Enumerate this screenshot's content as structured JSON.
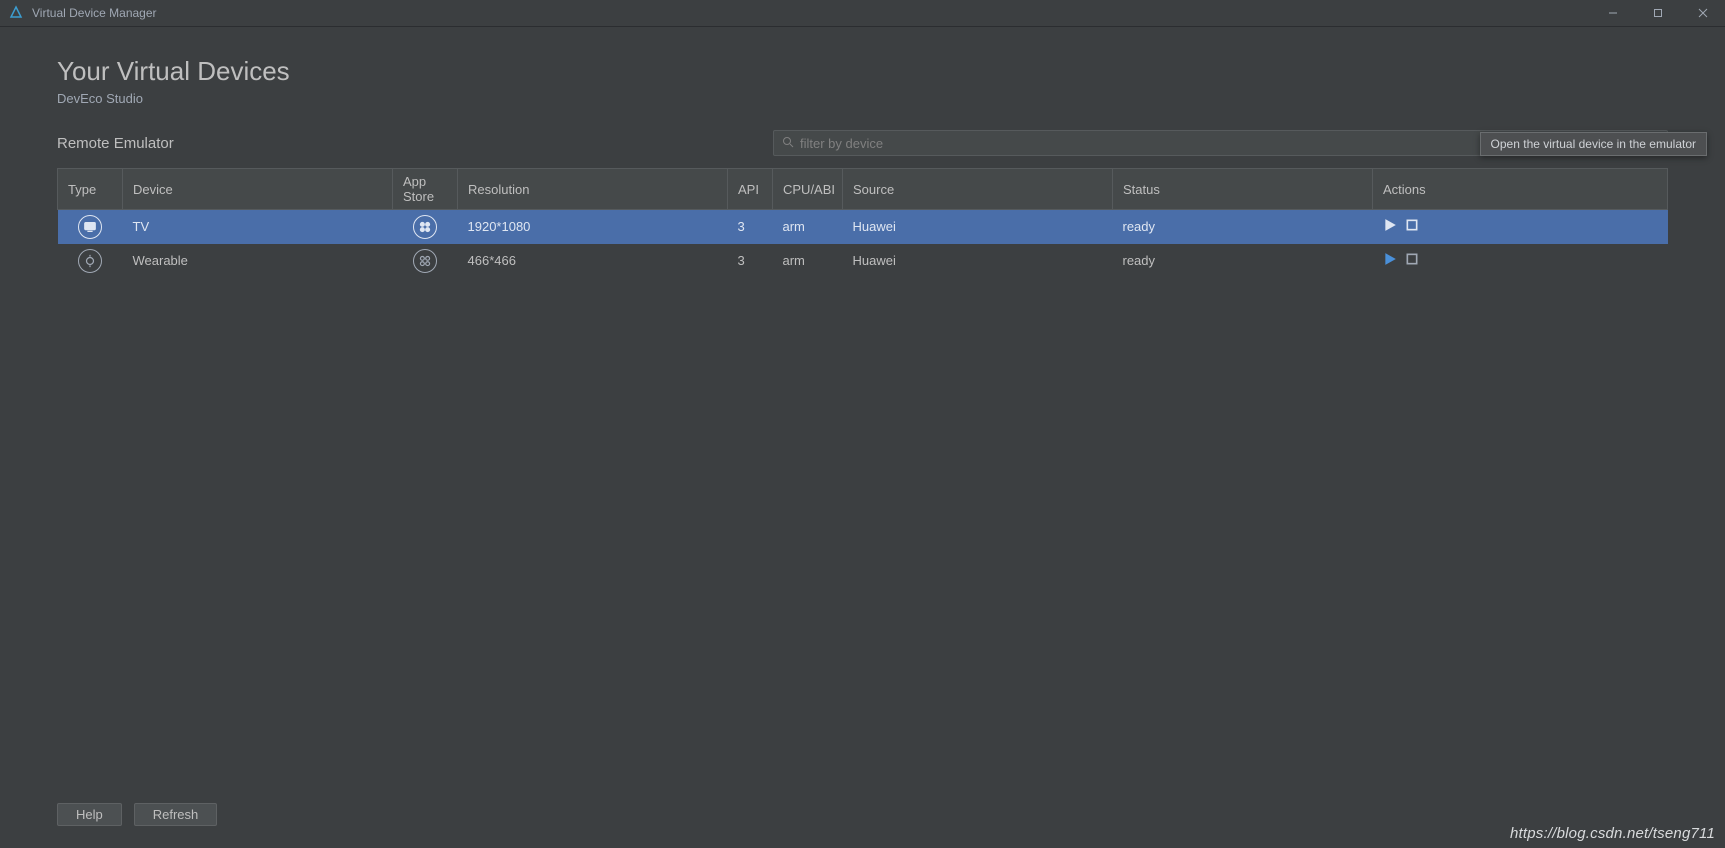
{
  "window": {
    "title": "Virtual Device Manager"
  },
  "header": {
    "title": "Your Virtual Devices",
    "subtitle": "DevEco Studio"
  },
  "section": {
    "label": "Remote Emulator"
  },
  "search": {
    "placeholder": "filter by device",
    "value": ""
  },
  "table": {
    "columns": {
      "type": "Type",
      "device": "Device",
      "appstore": "App Store",
      "resolution": "Resolution",
      "api": "API",
      "cpu": "CPU/ABI",
      "source": "Source",
      "status": "Status",
      "actions": "Actions"
    },
    "rows": [
      {
        "type_icon": "tv",
        "device": "TV",
        "appstore_icon": "appstore",
        "resolution": "1920*1080",
        "api": "3",
        "cpu": "arm",
        "source": "Huawei",
        "status": "ready",
        "selected": true
      },
      {
        "type_icon": "wearable",
        "device": "Wearable",
        "appstore_icon": "appstore",
        "resolution": "466*466",
        "api": "3",
        "cpu": "arm",
        "source": "Huawei",
        "status": "ready",
        "selected": false
      }
    ]
  },
  "tooltip": "Open the virtual device in the emulator",
  "buttons": {
    "help": "Help",
    "refresh": "Refresh"
  },
  "watermark": "https://blog.csdn.net/tseng711"
}
